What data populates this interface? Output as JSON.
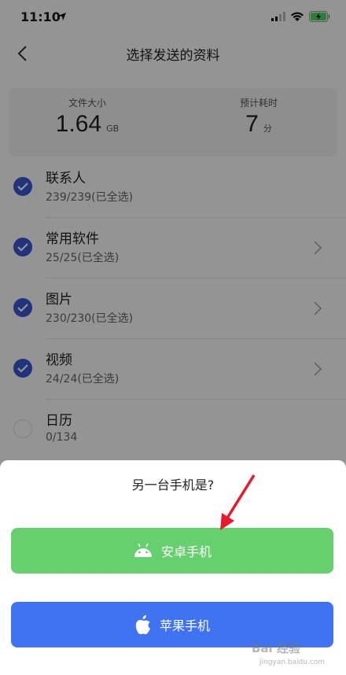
{
  "status": {
    "time": "11:10"
  },
  "nav": {
    "title": "选择发送的资料"
  },
  "summary": {
    "size_label": "文件大小",
    "size_value": "1.64",
    "size_unit": "GB",
    "time_label": "预计耗时",
    "time_value": "7",
    "time_unit": "分"
  },
  "items": [
    {
      "name": "联系人",
      "count": "239/239(已全选)",
      "checked": true,
      "arrow": false
    },
    {
      "name": "常用软件",
      "count": "25/25(已全选)",
      "checked": true,
      "arrow": true
    },
    {
      "name": "图片",
      "count": "230/230(已全选)",
      "checked": true,
      "arrow": true
    },
    {
      "name": "视频",
      "count": "24/24(已全选)",
      "checked": true,
      "arrow": true
    },
    {
      "name": "日历",
      "count": "0/134",
      "checked": false,
      "arrow": false
    }
  ],
  "sheet": {
    "title": "另一台手机是?",
    "android_label": "安卓手机",
    "apple_label": "苹果手机"
  },
  "colors": {
    "check_blue": "#3a59d6",
    "android_green": "#66d06f",
    "apple_blue": "#3f73f2",
    "annotation_red": "#e8192c"
  },
  "watermark": {
    "text": "Bai 经验",
    "sub": "jingyan.baidu.com"
  }
}
